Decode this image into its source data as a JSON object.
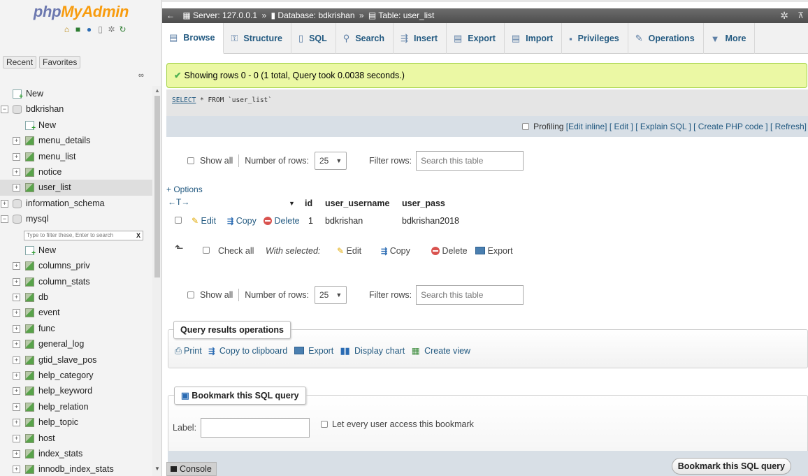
{
  "nav": {
    "logo_php": "php",
    "logo_rest": "MyAdmin",
    "recent": "Recent",
    "favorites": "Favorites",
    "filter_placeholder": "Type to filter these, Enter to search",
    "filter_clear": "X",
    "tree": [
      {
        "label": "New",
        "icon": "new",
        "level": 0,
        "expander": ""
      },
      {
        "label": "bdkrishan",
        "icon": "db",
        "level": 0,
        "expander": "−"
      },
      {
        "label": "New",
        "icon": "new",
        "level": 1,
        "expander": ""
      },
      {
        "label": "menu_details",
        "icon": "table",
        "level": 1,
        "expander": "+"
      },
      {
        "label": "menu_list",
        "icon": "table",
        "level": 1,
        "expander": "+"
      },
      {
        "label": "notice",
        "icon": "table",
        "level": 1,
        "expander": "+"
      },
      {
        "label": "user_list",
        "icon": "table",
        "level": 1,
        "expander": "+",
        "selected": true
      },
      {
        "label": "information_schema",
        "icon": "db",
        "level": 0,
        "expander": "+"
      },
      {
        "label": "mysql",
        "icon": "db",
        "level": 0,
        "expander": "−"
      },
      {
        "label": "",
        "icon": "filter",
        "level": 1,
        "expander": ""
      },
      {
        "label": "New",
        "icon": "new",
        "level": 1,
        "expander": ""
      },
      {
        "label": "columns_priv",
        "icon": "table",
        "level": 1,
        "expander": "+"
      },
      {
        "label": "column_stats",
        "icon": "table",
        "level": 1,
        "expander": "+"
      },
      {
        "label": "db",
        "icon": "table",
        "level": 1,
        "expander": "+"
      },
      {
        "label": "event",
        "icon": "table",
        "level": 1,
        "expander": "+"
      },
      {
        "label": "func",
        "icon": "table",
        "level": 1,
        "expander": "+"
      },
      {
        "label": "general_log",
        "icon": "table",
        "level": 1,
        "expander": "+"
      },
      {
        "label": "gtid_slave_pos",
        "icon": "table",
        "level": 1,
        "expander": "+"
      },
      {
        "label": "help_category",
        "icon": "table",
        "level": 1,
        "expander": "+"
      },
      {
        "label": "help_keyword",
        "icon": "table",
        "level": 1,
        "expander": "+"
      },
      {
        "label": "help_relation",
        "icon": "table",
        "level": 1,
        "expander": "+"
      },
      {
        "label": "help_topic",
        "icon": "table",
        "level": 1,
        "expander": "+"
      },
      {
        "label": "host",
        "icon": "table",
        "level": 1,
        "expander": "+"
      },
      {
        "label": "index_stats",
        "icon": "table",
        "level": 1,
        "expander": "+"
      },
      {
        "label": "innodb_index_stats",
        "icon": "table",
        "level": 1,
        "expander": "+"
      }
    ]
  },
  "breadcrumb": {
    "server": "Server: 127.0.0.1",
    "database": "Database: bdkrishan",
    "table": "Table: user_list",
    "separator": "»"
  },
  "tabs": [
    {
      "label": "Browse",
      "icon": "browse-icon",
      "glyph": "▤",
      "active": true
    },
    {
      "label": "Structure",
      "icon": "structure-icon",
      "glyph": "⚿"
    },
    {
      "label": "SQL",
      "icon": "sql-icon",
      "glyph": "▯"
    },
    {
      "label": "Search",
      "icon": "search-icon",
      "glyph": "⚲"
    },
    {
      "label": "Insert",
      "icon": "insert-icon",
      "glyph": "⇶"
    },
    {
      "label": "Export",
      "icon": "export-icon",
      "glyph": "▤"
    },
    {
      "label": "Import",
      "icon": "import-icon",
      "glyph": "▤"
    },
    {
      "label": "Privileges",
      "icon": "privileges-icon",
      "glyph": "▪"
    },
    {
      "label": "Operations",
      "icon": "operations-icon",
      "glyph": "✎"
    },
    {
      "label": "More",
      "icon": "more-icon",
      "glyph": "▼"
    }
  ],
  "message": {
    "text": "Showing rows 0 - 0 (1 total, Query took 0.0038 seconds.)"
  },
  "query": {
    "select_kw": "SELECT",
    "rest": " * FROM `user_list`"
  },
  "profiling": {
    "label": "Profiling",
    "links": [
      "[Edit inline]",
      "[ Edit ]",
      "[ Explain SQL ]",
      "[ Create PHP code ]",
      "[ Refresh]"
    ]
  },
  "navigation": {
    "show_all": "Show all",
    "number_of_rows": "Number of rows:",
    "rows_value": "25",
    "filter_rows": "Filter rows:",
    "search_placeholder": "Search this table"
  },
  "results": {
    "options": "+ Options",
    "arrows": "←T→",
    "columns": [
      "id",
      "user_username",
      "user_pass"
    ],
    "rows": [
      {
        "id": "1",
        "user_username": "bdkrishan",
        "user_pass": "bdkrishan2018"
      }
    ],
    "row_actions": {
      "edit": "Edit",
      "copy": "Copy",
      "delete": "Delete"
    }
  },
  "bulk": {
    "check_all": "Check all",
    "with_selected": "With selected:",
    "edit": "Edit",
    "copy": "Copy",
    "delete": "Delete",
    "export": "Export"
  },
  "query_ops": {
    "legend": "Query results operations",
    "print": "Print",
    "copy_clipboard": "Copy to clipboard",
    "export": "Export",
    "display_chart": "Display chart",
    "create_view": "Create view"
  },
  "bookmark": {
    "legend": "Bookmark this SQL query",
    "label": "Label:",
    "share": "Let every user access this bookmark",
    "submit": "Bookmark this SQL query"
  },
  "console": {
    "label": "Console"
  }
}
